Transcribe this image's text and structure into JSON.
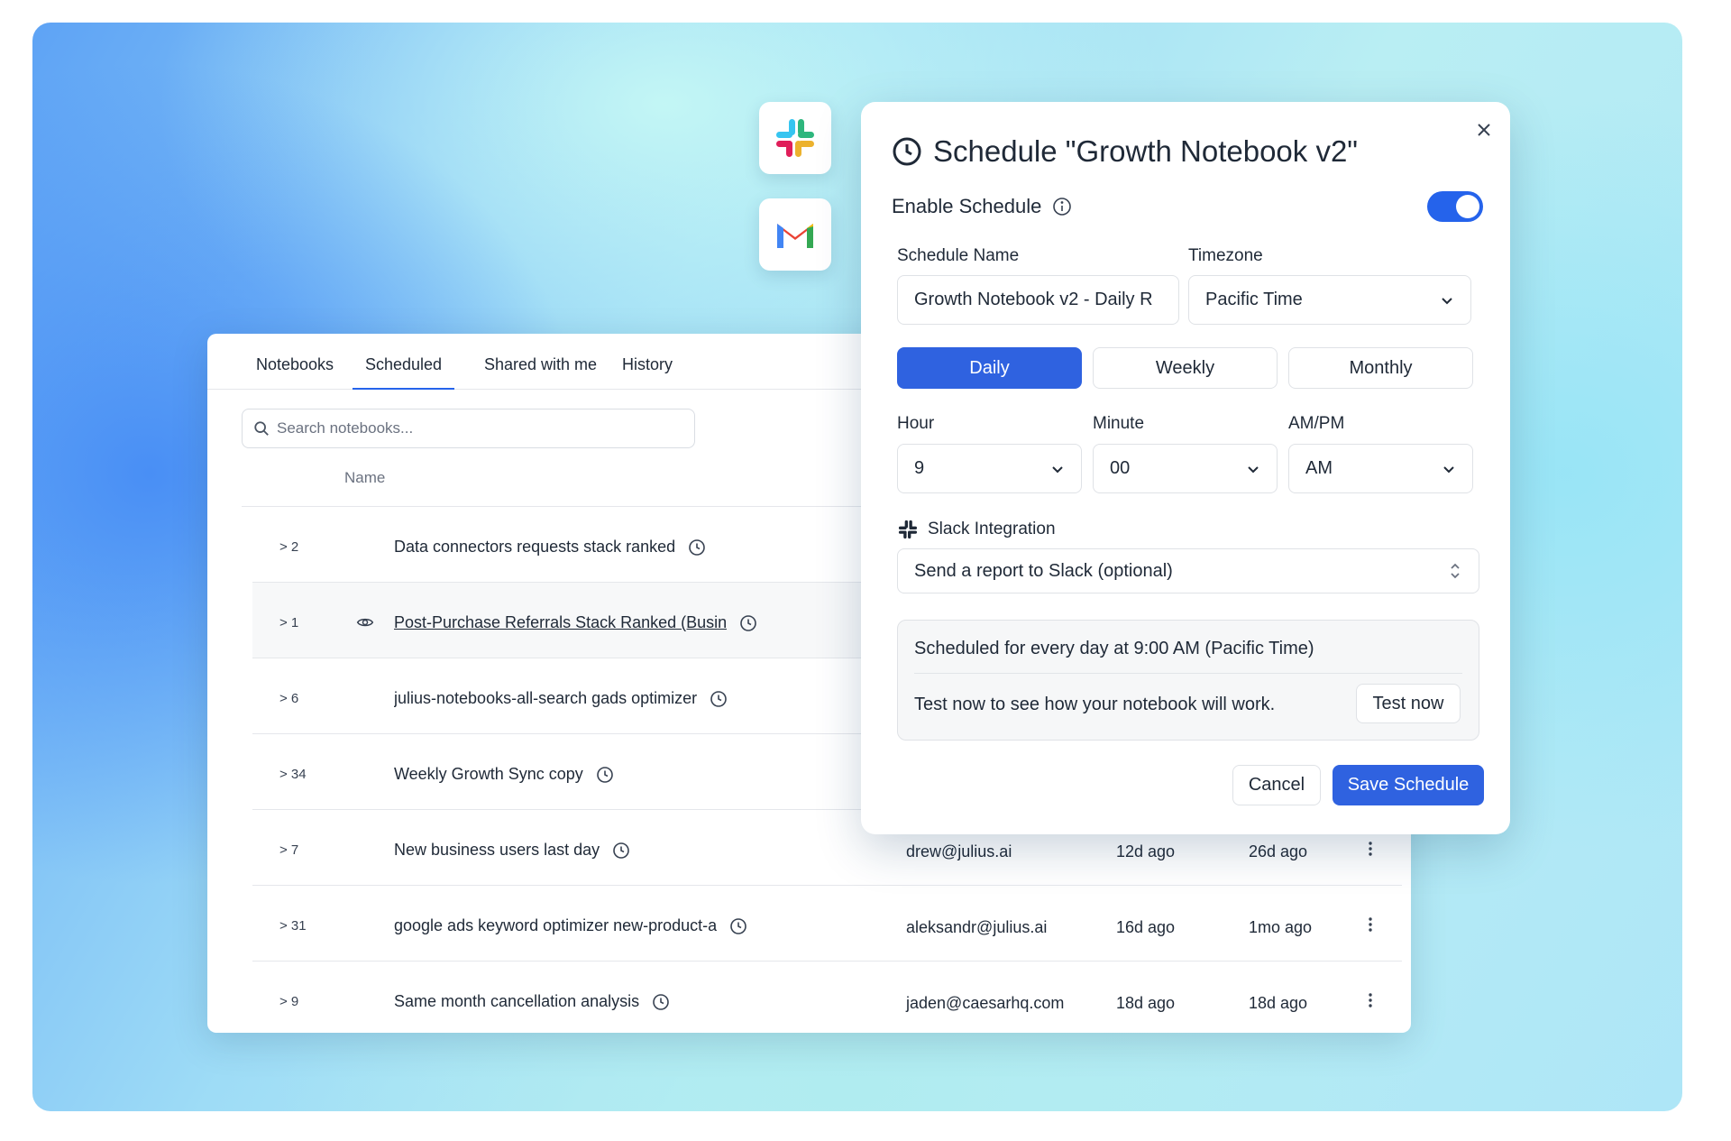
{
  "tabs": [
    {
      "label": "Notebooks"
    },
    {
      "label": "Scheduled"
    },
    {
      "label": "Shared with me"
    },
    {
      "label": "History"
    }
  ],
  "active_tab": "Scheduled",
  "search": {
    "placeholder": "Search notebooks...",
    "value": ""
  },
  "table": {
    "columns": {
      "name": "Name"
    },
    "rows": [
      {
        "count": "> 2",
        "name": "Data connectors requests stack ranked",
        "owner": "",
        "modified": "",
        "created": ""
      },
      {
        "count": "> 1",
        "name": "Post-Purchase Referrals Stack Ranked (Busin",
        "owner": "",
        "modified": "",
        "created": ""
      },
      {
        "count": "> 6",
        "name": "julius-notebooks-all-search gads optimizer",
        "owner": "",
        "modified": "",
        "created": ""
      },
      {
        "count": "> 34",
        "name": "Weekly Growth Sync copy",
        "owner": "",
        "modified": "",
        "created": ""
      },
      {
        "count": "> 7",
        "name": "New business users last day",
        "owner": "drew@julius.ai",
        "modified": "12d ago",
        "created": "26d ago"
      },
      {
        "count": "> 31",
        "name": "google ads keyword optimizer new-product-a",
        "owner": "aleksandr@julius.ai",
        "modified": "16d ago",
        "created": "1mo ago"
      },
      {
        "count": "> 9",
        "name": "Same month cancellation analysis",
        "owner": "jaden@caesarhq.com",
        "modified": "18d ago",
        "created": "18d ago"
      }
    ]
  },
  "dialog": {
    "title": "Schedule \"Growth Notebook v2\"",
    "enable_label": "Enable Schedule",
    "enabled": true,
    "schedule_name_label": "Schedule Name",
    "schedule_name_value": "Growth Notebook v2 - Daily R",
    "timezone_label": "Timezone",
    "timezone_value": "Pacific Time",
    "frequency": [
      "Daily",
      "Weekly",
      "Monthly"
    ],
    "frequency_selected": "Daily",
    "hour_label": "Hour",
    "hour_value": "9",
    "minute_label": "Minute",
    "minute_value": "00",
    "ampm_label": "AM/PM",
    "ampm_value": "AM",
    "slack_label": "Slack Integration",
    "slack_select": "Send a report to Slack (optional)",
    "summary_text": "Scheduled for every day at 9:00 AM (Pacific Time)",
    "test_hint": "Test now to see how your notebook will work.",
    "test_button": "Test now",
    "cancel_button": "Cancel",
    "save_button": "Save Schedule"
  },
  "colors": {
    "accent": "#2f62e0",
    "toggle_on": "#2563eb"
  },
  "icons": [
    "slack-logo-icon",
    "gmail-logo-icon",
    "search-icon",
    "clock-icon",
    "eye-icon",
    "kebab-menu-icon",
    "close-icon",
    "info-icon",
    "chevron-down-icon",
    "chevron-updown-icon"
  ]
}
